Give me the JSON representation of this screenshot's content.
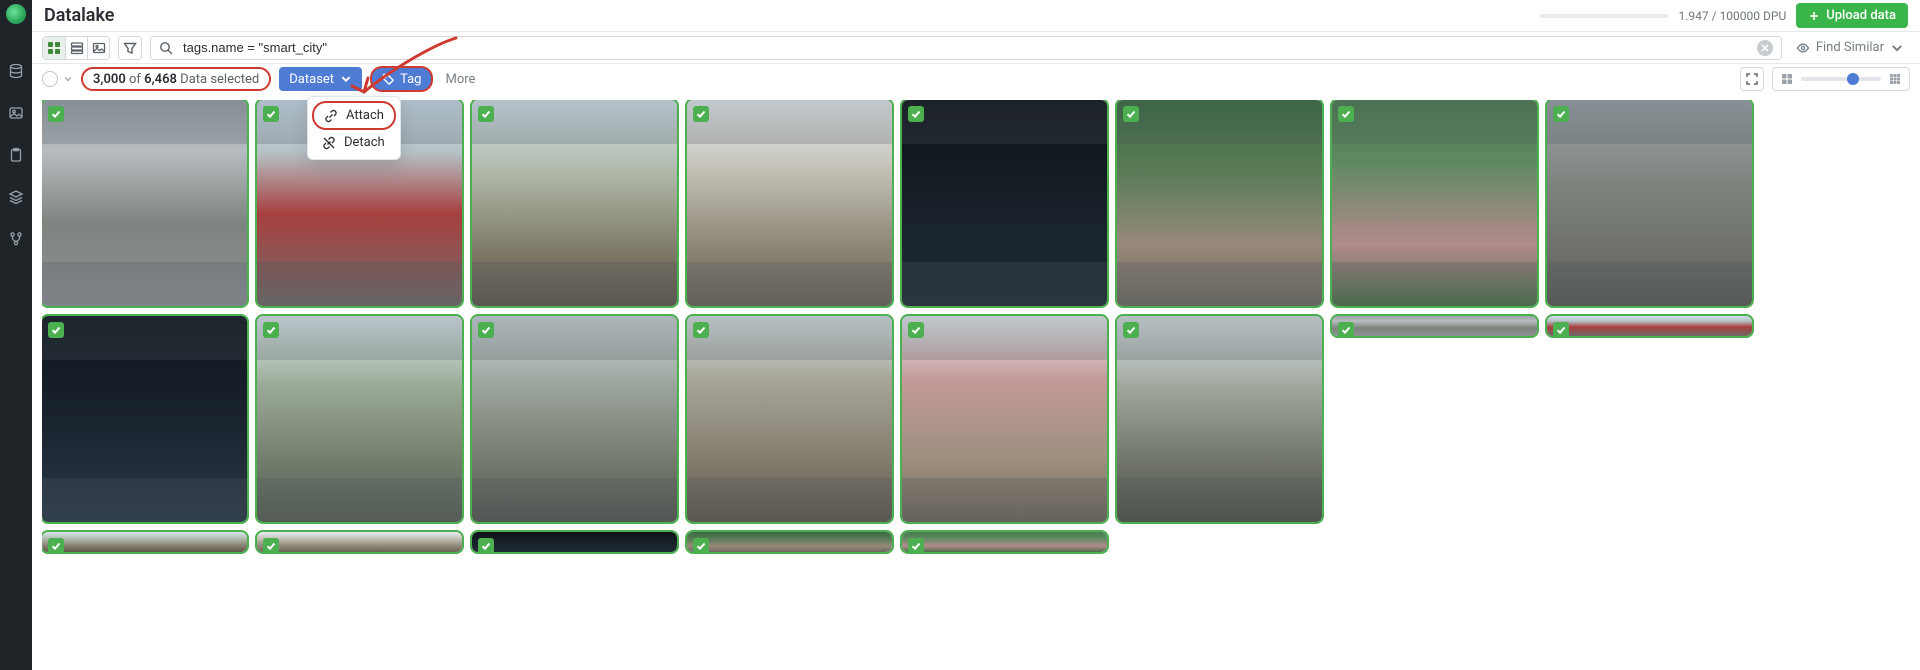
{
  "page_title": "Datalake",
  "dpu": {
    "used": "1.947",
    "total": "100000",
    "label_suffix": "DPU"
  },
  "upload_label": "Upload data",
  "search": {
    "value": "tags.name = \"smart_city\""
  },
  "find_similar_label": "Find Similar",
  "selection": {
    "count": "3,000",
    "of_word": "of",
    "total": "6,468",
    "suffix": "Data selected"
  },
  "toolbar": {
    "dataset_label": "Dataset",
    "tag_label": "Tag",
    "more_label": "More"
  },
  "tag_menu": {
    "attach": "Attach",
    "detach": "Detach"
  },
  "rail": {
    "items": [
      "database",
      "image",
      "clipboard",
      "layers",
      "branch"
    ]
  },
  "view_modes": [
    "grid",
    "list",
    "thumb"
  ],
  "gallery": {
    "rows": 3,
    "cols": 7,
    "all_selected": true,
    "thumb_styles": [
      "linear-gradient(#9aa3a7 0%, #b6bcc0 25%, #7e847e 60%, #8d9296 100%)",
      "linear-gradient(#cfe0ec 0%, #b5c3c8 25%, #a84040 55%, #6e6a66 100%)",
      "linear-gradient(#d6e6ef 0%, #a9b1a0 40%, #7d7766 75%, #5e574c 100%)",
      "linear-gradient(#e8eef1 0%, #c8c6bd 30%, #8f8778 70%, #6a6356 100%)",
      "linear-gradient(#0c1116 0%, #1a232c 60%, #1e2a33 100%)",
      "linear-gradient(#386a3f 0%, #5a7c57 35%, #97897a 70%, #6f6a61 100%)",
      "linear-gradient(#4c7b4f 0%, #5d8a60 30%, #b38a8d 70%, #497049 100%)",
      "linear-gradient(#9aa3a7 0%, #7e847e 40%, #6c7068 75%, #575b55 100%)",
      "linear-gradient(#0e141b 0%, #1b2530 55%, #2a3a48 100%)",
      "linear-gradient(#dfeaf0 0%, #99a894 35%, #6d7868 75%, #565e52 100%)",
      "linear-gradient(#cbd6d9 0%, #9aa39a 35%, #6f7468 75%, #535750 100%)",
      "linear-gradient(#d9e4e7 0%, #a8a79a 30%, #7e7668 75%, #5d574c 100%)",
      "linear-gradient(#e6eff3 0%, #c59b9a 30%, #9d8f7e 70%, #6e665a 100%)",
      "linear-gradient(#d7e2e5 0%, #9fa69c 35%, #6b6f64 75%, #4f534a 100%)"
    ]
  }
}
